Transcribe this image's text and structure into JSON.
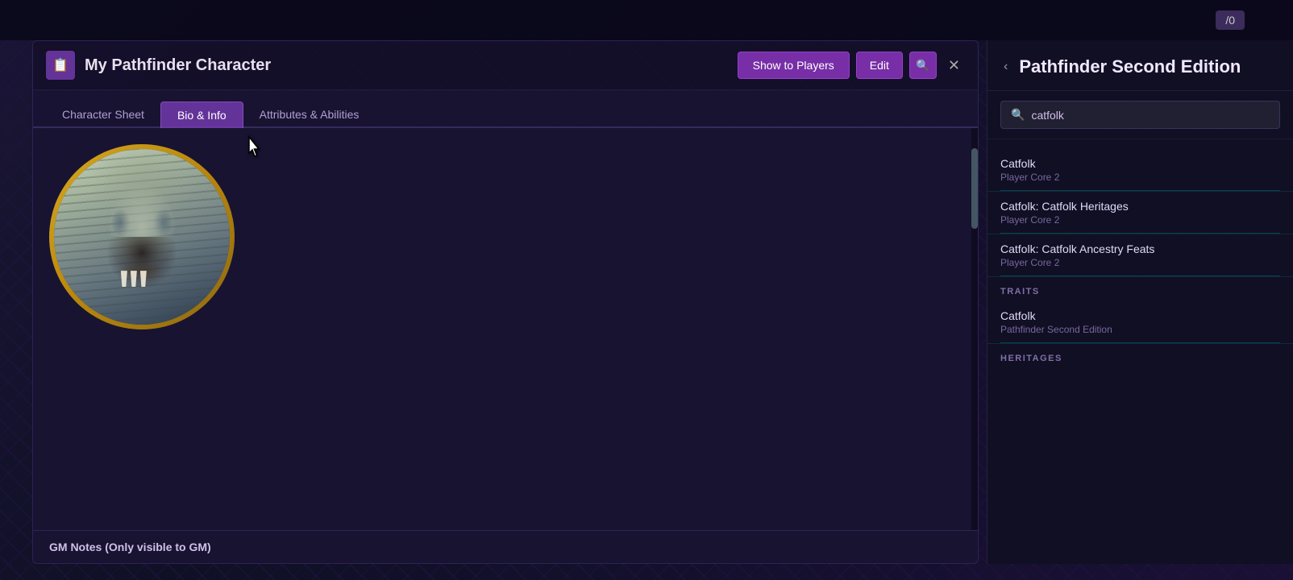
{
  "topbar": {
    "counter": "/0"
  },
  "sheet": {
    "icon": "📋",
    "title": "My Pathfinder Character",
    "buttons": {
      "show": "Show to Players",
      "edit": "Edit",
      "search": "🔍",
      "close": "✕"
    },
    "tabs": [
      {
        "id": "character-sheet",
        "label": "Character Sheet",
        "active": false
      },
      {
        "id": "bio-info",
        "label": "Bio & Info",
        "active": true
      },
      {
        "id": "attributes",
        "label": "Attributes & Abilities",
        "active": false
      }
    ],
    "footer": {
      "gm_notes": "GM Notes (Only visible to GM)"
    }
  },
  "sidebar": {
    "back_icon": "‹",
    "title": "Pathfinder Second Edition",
    "search": {
      "placeholder": "Search...",
      "value": "catfolk",
      "icon": "🔍"
    },
    "sections": [
      {
        "id": "compendium",
        "label": "",
        "items": [
          {
            "name": "Catfolk",
            "source": "Player Core 2"
          },
          {
            "name": "Catfolk: Catfolk Heritages",
            "source": "Player Core 2"
          },
          {
            "name": "Catfolk: Catfolk Ancestry Feats",
            "source": "Player Core 2"
          }
        ]
      },
      {
        "id": "traits",
        "label": "TRAITS",
        "items": [
          {
            "name": "Catfolk",
            "source": "Pathfinder Second Edition"
          }
        ]
      },
      {
        "id": "heritages",
        "label": "HERITAGES",
        "items": []
      }
    ]
  }
}
